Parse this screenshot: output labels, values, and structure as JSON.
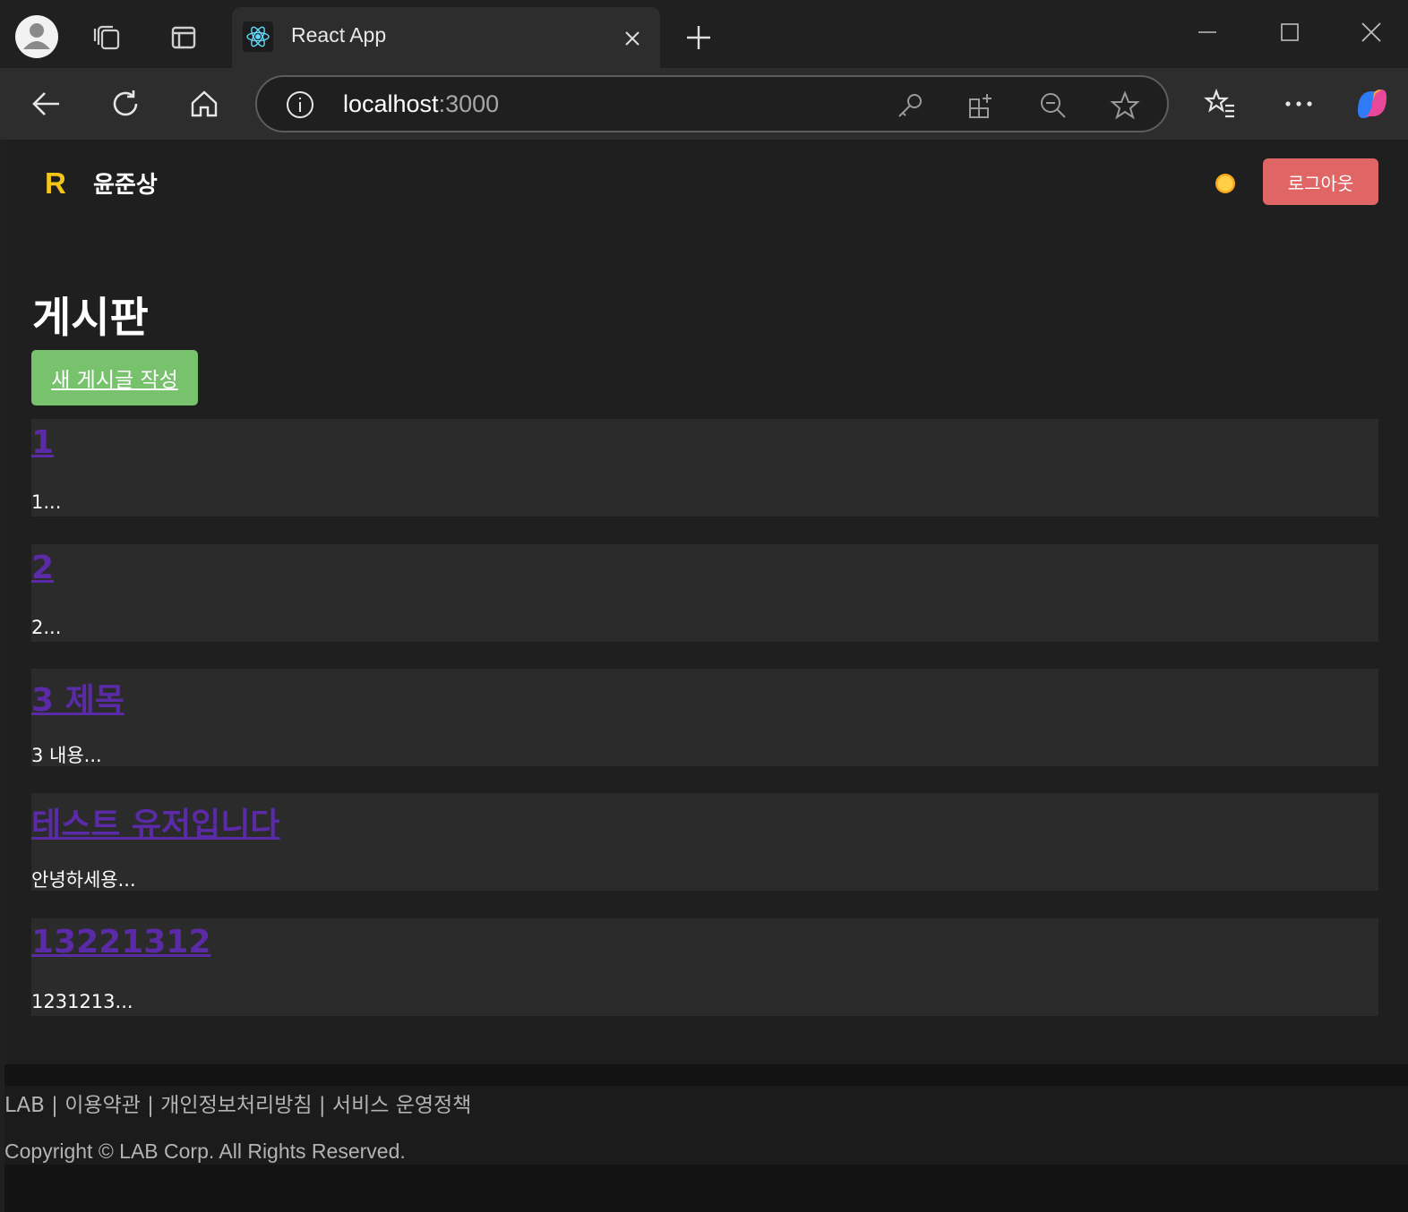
{
  "browser": {
    "tab_title": "React App",
    "url_host": "localhost",
    "url_port": ":3000"
  },
  "header": {
    "logo": "R",
    "username": "윤준상",
    "logout_label": "로그아웃"
  },
  "board": {
    "title": "게시판",
    "new_post_label": "새 게시글 작성",
    "posts": [
      {
        "title": "1",
        "excerpt": "1..."
      },
      {
        "title": "2",
        "excerpt": "2..."
      },
      {
        "title": "3 제목",
        "excerpt": "3 내용..."
      },
      {
        "title": "테스트 유저입니다",
        "excerpt": "안녕하세용..."
      },
      {
        "title": "13221312",
        "excerpt": "1231213..."
      }
    ]
  },
  "footer": {
    "links": [
      "LAB",
      "이용약관",
      "개인정보처리방침",
      "서비스 운영정책"
    ],
    "separator": " | ",
    "copyright": "Copyright © LAB Corp. All Rights Reserved."
  },
  "colors": {
    "accent_logo": "#f5c518",
    "logout_button": "#e06666",
    "new_post_button": "#78c26e",
    "post_link": "#5b2aa6"
  }
}
